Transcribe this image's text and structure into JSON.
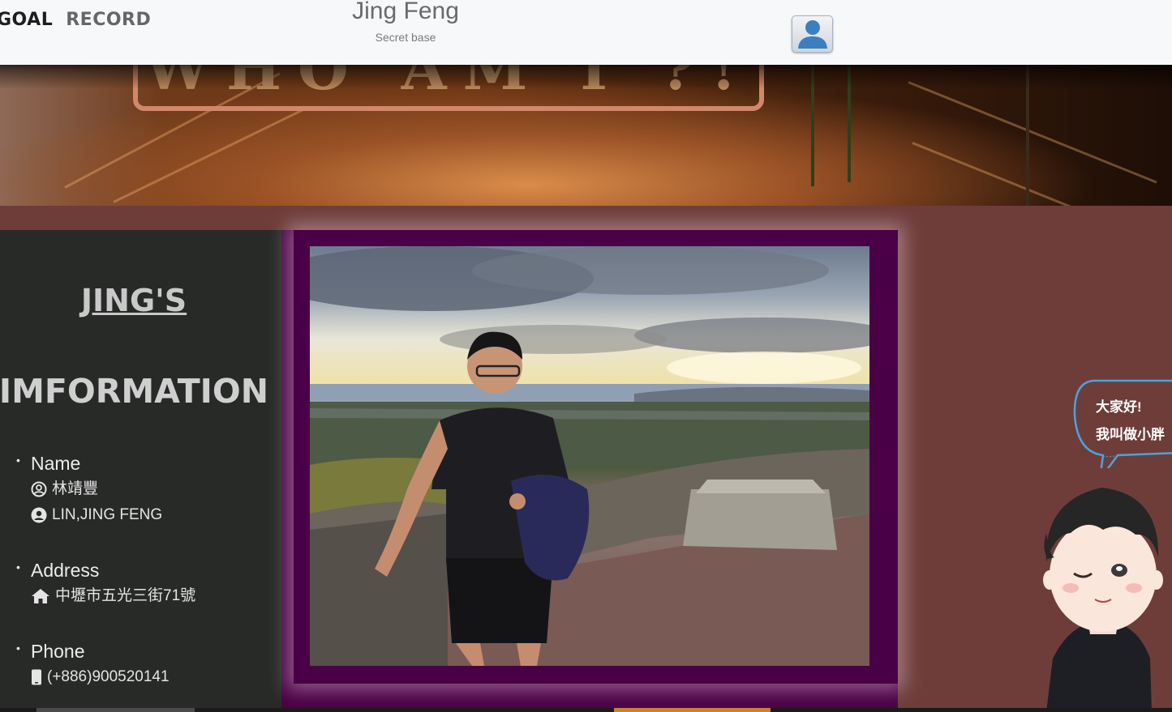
{
  "nav": {
    "links": [
      "GOAL",
      "RECORD"
    ],
    "brand_title": "Jing Feng",
    "brand_subtitle": "Secret base",
    "avatar_icon": "user-icon"
  },
  "hero": {
    "sign_text": "WHO AM I ?!"
  },
  "info": {
    "title_line1": "JING'S",
    "title_line2": "IMFORMATION",
    "name_label": "Name",
    "name_zh": "林靖豐",
    "name_en": "LIN,JING FENG",
    "address_label": "Address",
    "address_value": "中壢市五光三街71號",
    "phone_label": "Phone",
    "phone_value": "(+886)900520141"
  },
  "mascot": {
    "greeting_line1": "大家好!",
    "greeting_line2": "我叫做小胖"
  },
  "colors": {
    "page_bg": "#6e3d3a",
    "panel_bg": "#282a28",
    "frame": "#4a0046",
    "bubble_stroke": "#4aa3e0"
  }
}
